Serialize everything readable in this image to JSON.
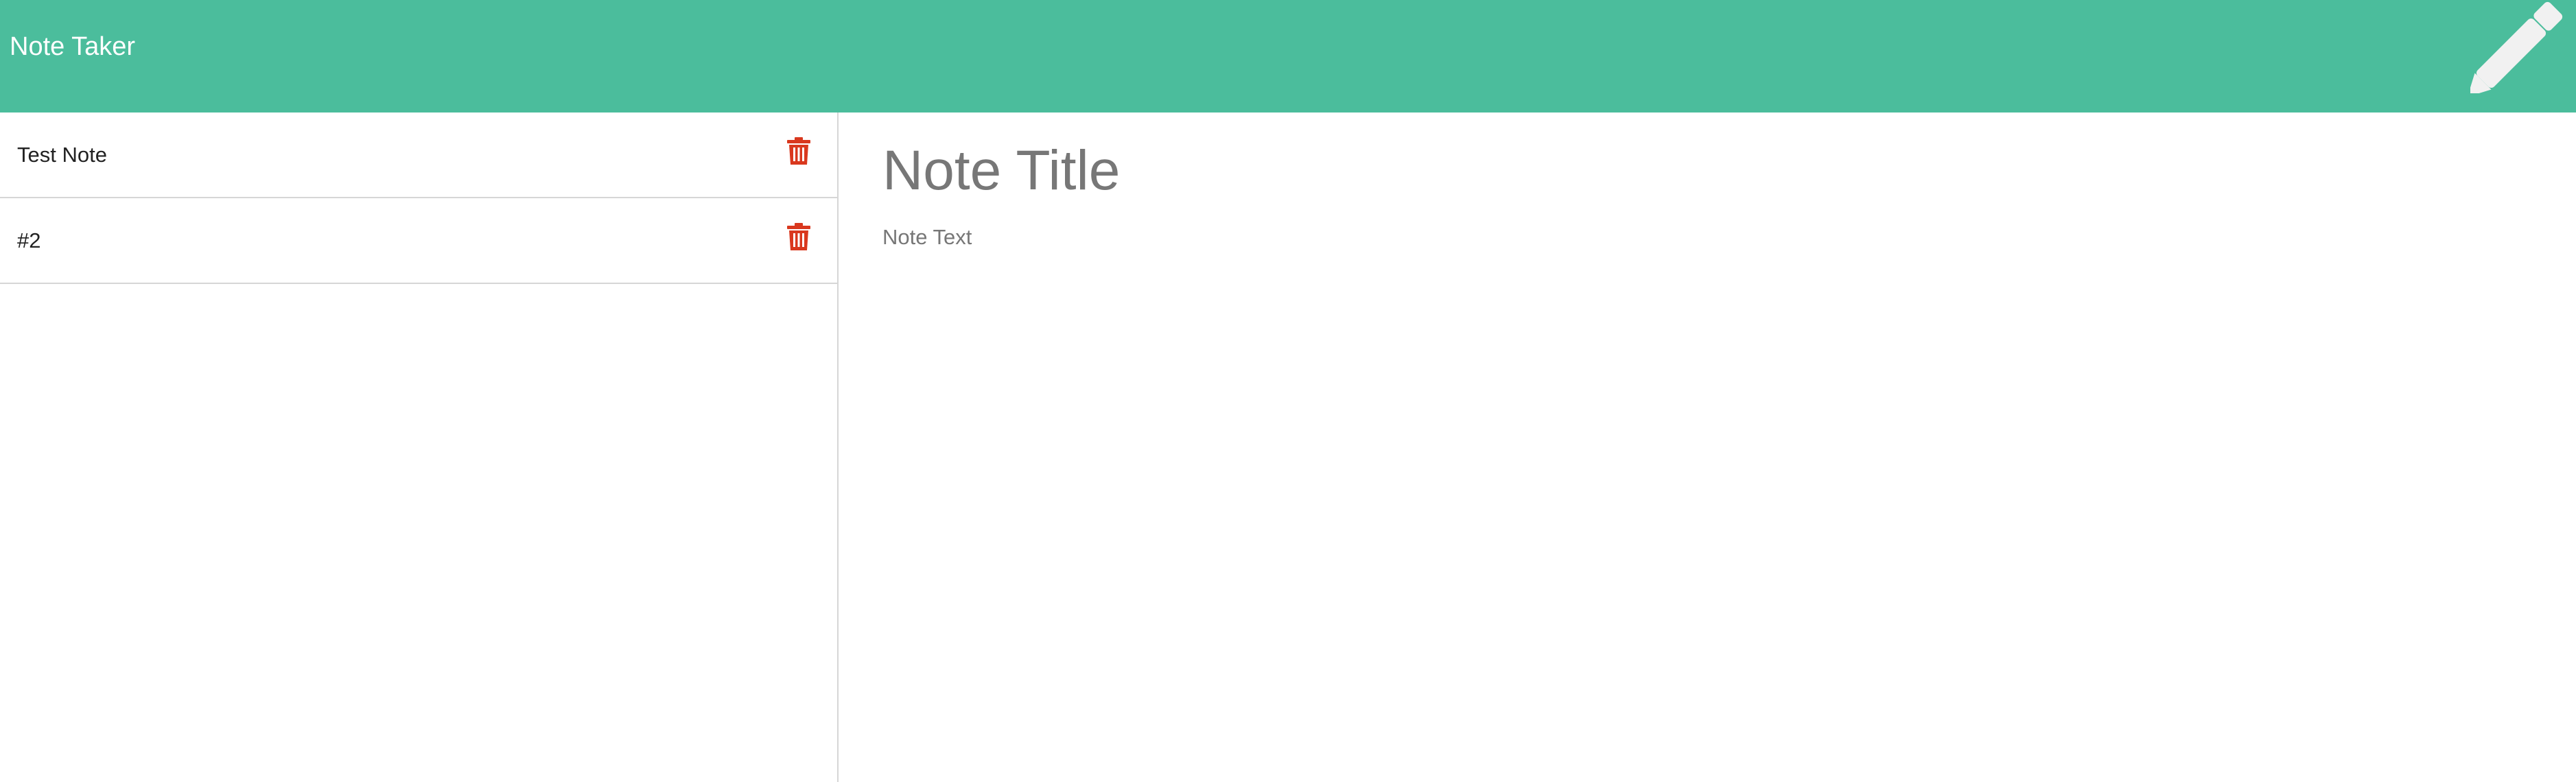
{
  "navbar": {
    "brand": "Note Taker",
    "new_note_icon": "pencil-icon",
    "background_color": "#4bbd9c"
  },
  "sidebar": {
    "notes": [
      {
        "title": "Test Note",
        "delete_icon": "trash-icon"
      },
      {
        "title": "#2",
        "delete_icon": "trash-icon"
      }
    ],
    "delete_icon_color": "#d9381e"
  },
  "editor": {
    "title_placeholder": "Note Title",
    "text_placeholder": "Note Text"
  }
}
